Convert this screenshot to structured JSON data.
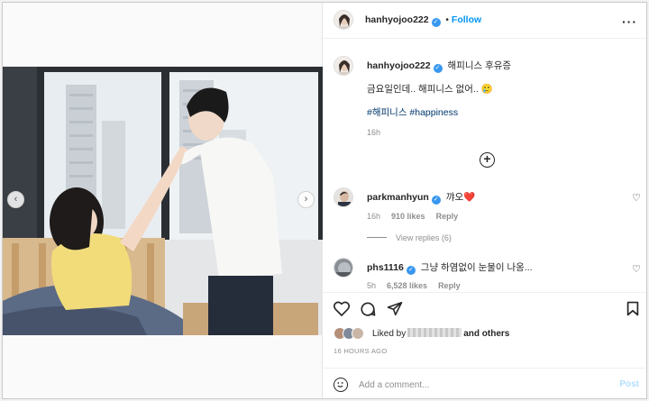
{
  "post": {
    "username": "hanhyojoo222",
    "follow_label": "Follow",
    "more_icon": "more-horizontal-icon"
  },
  "caption": {
    "username": "hanhyojoo222",
    "title": "해피니스 후유증",
    "line": "금요일인데.. 해피니스 없어..",
    "emoji": "🥲",
    "hashtags": "#해피니스 #happiness",
    "time": "16h"
  },
  "comments": [
    {
      "username": "parkmanhyun",
      "text": "꺄오",
      "emoji": "❤️",
      "time": "16h",
      "likes": "910 likes",
      "reply_label": "Reply"
    },
    {
      "username": "phs1116",
      "text": "그냥 하염없이 눈물이 나옹...",
      "time": "5h",
      "likes": "6,528 likes",
      "reply_label": "Reply"
    }
  ],
  "view_replies": "View replies (6)",
  "liked_by": {
    "prefix": "Liked by",
    "suffix": "and others"
  },
  "time_ago": "16 HOURS AGO",
  "add_comment": {
    "placeholder": "Add a comment...",
    "post_label": "Post"
  },
  "colors": {
    "accent": "#0095f6",
    "verified": "#3897f0",
    "heart": "#ed4956",
    "photo_shirt_yellow": "#f2dc7a"
  },
  "icons": [
    "heart-icon",
    "comment-icon",
    "share-icon",
    "bookmark-icon",
    "emoji-icon",
    "add-circle-icon",
    "chevron-left-icon",
    "chevron-right-icon"
  ]
}
